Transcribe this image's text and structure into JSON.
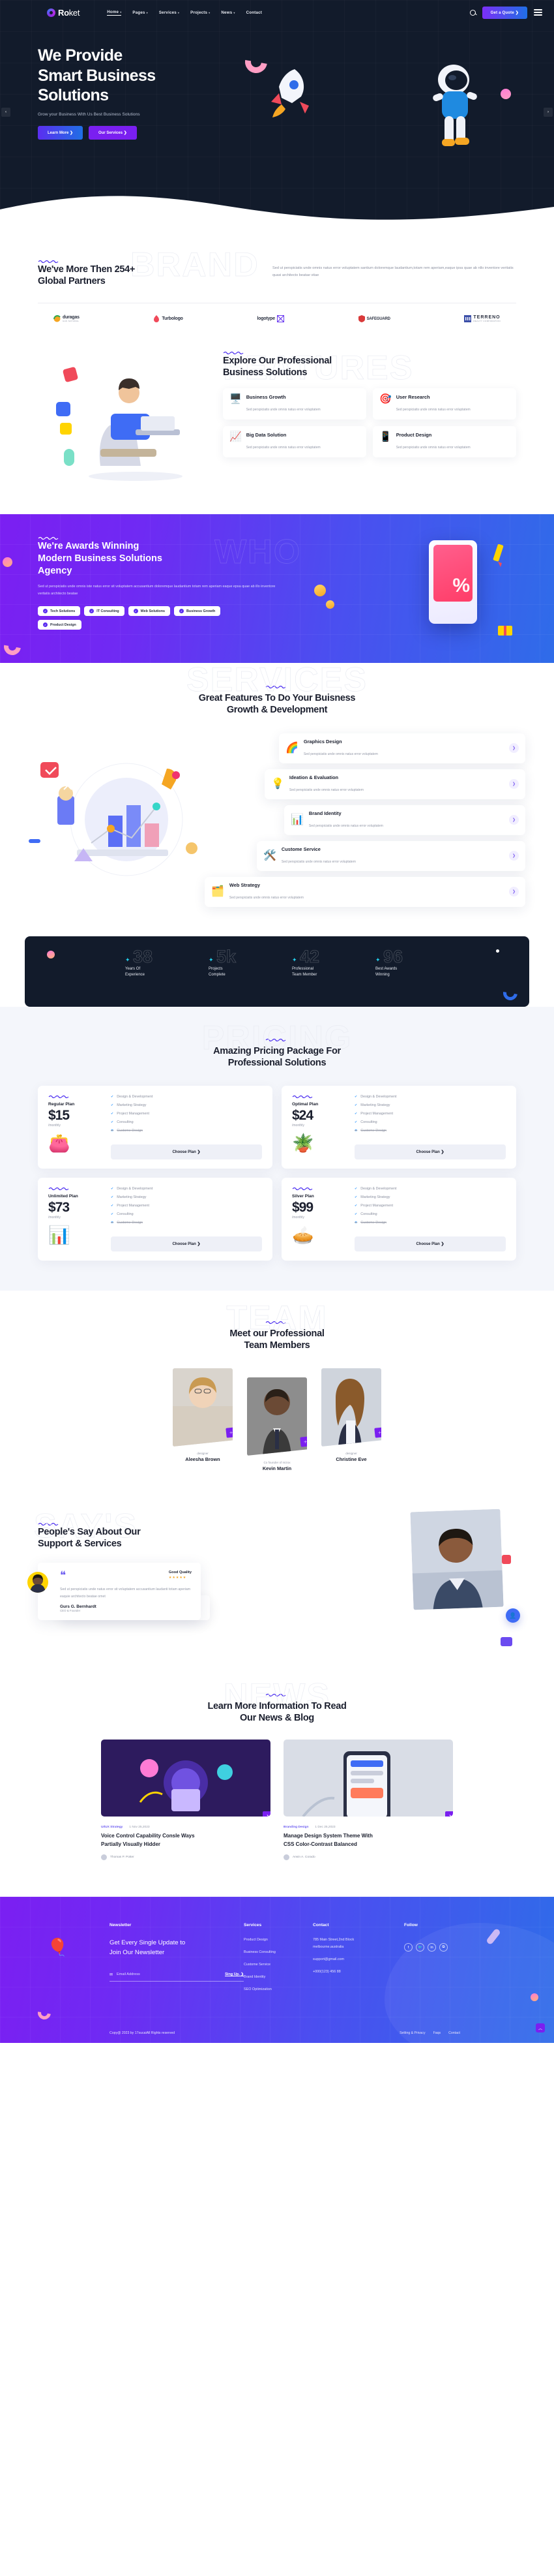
{
  "header": {
    "logo": "Roket",
    "logo_bold": "Ro",
    "logo_thin": "ket",
    "nav": [
      {
        "label": "Home",
        "caret": "▾",
        "active": true
      },
      {
        "label": "Pages",
        "caret": "▾",
        "active": false
      },
      {
        "label": "Services",
        "caret": "▾",
        "active": false
      },
      {
        "label": "Projects",
        "caret": "▾",
        "active": false
      },
      {
        "label": "News",
        "caret": "▾",
        "active": false
      },
      {
        "label": "Contact",
        "caret": "",
        "active": false
      }
    ],
    "search_icon": "search-icon",
    "quote_button": "Get a Quote",
    "quote_caret": "❯"
  },
  "hero": {
    "title_line1": "We Provide",
    "title_line2": "Smart Business",
    "title_line3": "Solutions",
    "subtitle": "Grow your Business With Us Best Business Solutions",
    "btn_primary": "Learn More",
    "btn_primary_caret": "❯",
    "btn_secondary": "Our Services",
    "btn_secondary_caret": "❯",
    "arrow_left": "‹",
    "arrow_right": "›"
  },
  "partners": {
    "ghost": "BRAND",
    "title_line1": "We've More Then 254+",
    "title_line2": "Global Partners",
    "paragraph": "Sed ut perspiciatis unde omnis natus error voluptatem santium doloremque laudantium,totam rem aperiam,eaque ipsa quae ab nllo inventore veritatis quasi architecto beatae vitae",
    "logos": [
      {
        "name": "duragas",
        "sub": "GAS NATURAL"
      },
      {
        "name": "Turbologo",
        "sub": ""
      },
      {
        "name": "logotype",
        "sub": ""
      },
      {
        "name": "SAFEGUARD",
        "sub": ""
      },
      {
        "name": "TERRENO",
        "sub": "REALTY CORPORATION"
      }
    ]
  },
  "explore": {
    "ghost": "FEATURES",
    "title_line1": "Explore Our Professional",
    "title_line2": "Business Solutions",
    "cards": [
      {
        "icon": "🖥️",
        "title": "Business Growth",
        "desc": "Sed perspiciatis unde omnis natus error voluptatem"
      },
      {
        "icon": "🎯",
        "title": "User Research",
        "desc": "Sed perspiciatis unde omnis natus error voluptatem"
      },
      {
        "icon": "📈",
        "title": "Big Data Solution",
        "desc": "Sed perspiciatis unde omnis natus error voluptatem"
      },
      {
        "icon": "📱",
        "title": "Product Design",
        "desc": "Sed perspiciatis unde omnis natus error voluptatem"
      }
    ]
  },
  "awards": {
    "ghost": "WHO",
    "title_line1": "We're Awards Winning",
    "title_line2": "Modern Business Solutions",
    "title_line3": "Agency",
    "paragraph": "Sed ut perspiciatis unde omnis iste natus error sit voluptatem accusantium doloremque laudantium totam rem aperiam eaque epsa quae ab illo inventore veritatis architecto beatae",
    "chips": [
      "Tech Solutions",
      "IT Consulting",
      "Web Solutions",
      "Business Growth",
      "Product Design"
    ],
    "percent": "%"
  },
  "services": {
    "ghost": "SERVICES",
    "title_line1": "Great Features To Do Your Buisness",
    "title_line2": "Growth & Development",
    "items": [
      {
        "icon": "🌈",
        "title": "Graphics Design",
        "desc": "Sed perspiciatis unde omnis natus error voluptatem",
        "arrow": "❯"
      },
      {
        "icon": "💡",
        "title": "Ideation & Evaluation",
        "desc": "Sed perspiciatis unde omnis natus error voluptatem",
        "arrow": "❯"
      },
      {
        "icon": "📊",
        "title": "Brand Identity",
        "desc": "Sed perspiciatis unde omnis natus error voluptatem",
        "arrow": "❯"
      },
      {
        "icon": "🛠️",
        "title": "Custome Service",
        "desc": "Sed perspiciatis unde omnis natus error voluptatem",
        "arrow": "❯"
      },
      {
        "icon": "🗂️",
        "title": "Web Strategy",
        "desc": "Sed perspiciatis unde omnis natus error voluptatem",
        "arrow": "❯"
      }
    ]
  },
  "counters": [
    {
      "number": "38",
      "icon": "✦",
      "label_line1": "Years Of",
      "label_line2": "Experience"
    },
    {
      "number": "5k",
      "icon": "✦",
      "label_line1": "Projects",
      "label_line2": "Complete"
    },
    {
      "number": "42",
      "icon": "✦",
      "label_line1": "Professional",
      "label_line2": "Team Member"
    },
    {
      "number": "96",
      "icon": "✦",
      "label_line1": "Best Awards",
      "label_line2": "Winning"
    }
  ],
  "pricing": {
    "ghost": "PRICING",
    "title_line1": "Amazing Pricing Package For",
    "title_line2": "Professional Solutions",
    "button_label": "Choose Plan",
    "button_caret": "❯",
    "plans": [
      {
        "name": "Regular Plan",
        "price": "$15",
        "per": "/monthly",
        "emoji": "👛",
        "features": [
          {
            "t": "Design & Development",
            "off": false
          },
          {
            "t": "Marketing Strategy",
            "off": false
          },
          {
            "t": "Project Management",
            "off": false
          },
          {
            "t": "Consulting",
            "off": false
          },
          {
            "t": "Custome Design",
            "off": true
          }
        ]
      },
      {
        "name": "Optimal Plan",
        "price": "$24",
        "per": "/monthly",
        "emoji": "🪴",
        "features": [
          {
            "t": "Design & Development",
            "off": false
          },
          {
            "t": "Marketing Strategy",
            "off": false
          },
          {
            "t": "Project Management",
            "off": false
          },
          {
            "t": "Consulting",
            "off": false
          },
          {
            "t": "Custome Design",
            "off": true
          }
        ]
      },
      {
        "name": "Unlimited Plan",
        "price": "$73",
        "per": "/monthly",
        "emoji": "📊",
        "features": [
          {
            "t": "Design & Development",
            "off": false
          },
          {
            "t": "Marketing Strategy",
            "off": false
          },
          {
            "t": "Project Management",
            "off": false
          },
          {
            "t": "Consulting",
            "off": false
          },
          {
            "t": "Custome Design",
            "off": true
          }
        ]
      },
      {
        "name": "Silver Plan",
        "price": "$99",
        "per": "/monthly",
        "emoji": "🥧",
        "features": [
          {
            "t": "Design & Development",
            "off": false
          },
          {
            "t": "Marketing Strategy",
            "off": false
          },
          {
            "t": "Project Management",
            "off": false
          },
          {
            "t": "Consulting",
            "off": false
          },
          {
            "t": "Custome Design",
            "off": true
          }
        ]
      }
    ]
  },
  "team": {
    "ghost": "TEAM",
    "title_line1": "Meet our Professional",
    "title_line2": "Team Members",
    "members": [
      {
        "name": "Aleesha Brown",
        "role": "designer",
        "badge": "＋"
      },
      {
        "name": "Kevin Martin",
        "role": "Co founder of mizox",
        "badge": "＋"
      },
      {
        "name": "Christine Eve",
        "role": "designer",
        "badge": "＋"
      }
    ]
  },
  "testimonials": {
    "ghost": "SAY'S",
    "title_line1": "People's Say About Our",
    "title_line2": "Support & Services",
    "quality_label": "Good Quality",
    "stars": "★★★★★",
    "front": {
      "quote": "Sed ut perspiciatis unde natus error sit voluptatem accusantium laudanti totam aperiam eaquie architecto beatae omet",
      "name": "Gurs G. Bernhardt",
      "role": "CEO & Founder"
    },
    "back": {
      "name": "Gurs G. Bernhardt"
    }
  },
  "blog": {
    "ghost": "NEWS",
    "title_line1": "Learn More Information To Read",
    "title_line2": "Our News & Blog",
    "posts": [
      {
        "cat": "UI/UX Strategy",
        "date": "1 Nov 25,2023",
        "title_line1": "Voice Control Capability Consle Ways",
        "title_line2": "Partially Visually Hidder",
        "author": "Thomas P. Potter",
        "badge": "❯"
      },
      {
        "cat": "Branding Design",
        "date": "1 Dec 25,2023",
        "title_line1": "Manage Design System Theme With",
        "title_line2": "CSS Color-Contrast Balanced",
        "author": "Arwin A. Corado",
        "badge": "❯"
      }
    ]
  },
  "footer": {
    "newsletter_heading": "Newsletter",
    "newsletter_line1": "Get Every Single Update to",
    "newsletter_line2": "Join Our Newsletter",
    "email_placeholder": "Email Address",
    "mail_icon": "✉",
    "signup_label": "Sing Up.",
    "signup_caret": "❯",
    "services_heading": "Services",
    "services": [
      "Product Design",
      "Business Consulting",
      "Custome Service",
      "Brand Identity",
      "SEO Optimization"
    ],
    "contact_heading": "Contact",
    "contact": [
      "785 Main Street,2nd Block",
      "melbourne.australia",
      "support@gmail.com",
      "+000(123) 456 88"
    ],
    "follow_heading": "Follow",
    "socials": [
      "f",
      "🐦",
      "in",
      "⧉"
    ],
    "copyright": "Copy@ 2023 by 17sucaiAll Rights reserved",
    "bottom_links": [
      "Setting & Privacy",
      "Faqs",
      "Contact"
    ],
    "scroll_top": "︿"
  }
}
